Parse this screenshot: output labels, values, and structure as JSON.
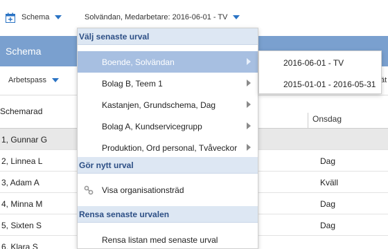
{
  "toolbar": {
    "schema_label": "Schema",
    "selection_label": "Solvändan, Medarbetare: 2016-06-01 - TV",
    "accent": "#2a73c4"
  },
  "band": {
    "title": "Schema",
    "color": "#7aa0cf"
  },
  "toolbar2": {
    "arbetspass_label": "Arbetspass",
    "right_fragment": "ät"
  },
  "grid": {
    "col_schemarad": "Schemarad",
    "col_onsdag": "Onsdag",
    "rows": [
      {
        "name": "1, Gunnar G",
        "onsdag": ""
      },
      {
        "name": "2, Linnea L",
        "onsdag": "Dag"
      },
      {
        "name": "3, Adam A",
        "onsdag": "Kväll"
      },
      {
        "name": "4, Minna M",
        "onsdag": "Dag"
      },
      {
        "name": "5, Sixten S",
        "onsdag": "Dag"
      },
      {
        "name": "6, Klara S",
        "onsdag": ""
      }
    ]
  },
  "dropdown": {
    "recent_header": "Välj senaste urval",
    "recent_items": [
      "Boende, Solvändan",
      "Bolag B, Teem 1",
      "Kastanjen, Grundschema, Dag",
      "Bolag A, Kundservicegrupp",
      "Produktion, Ord personal, Tvåveckor"
    ],
    "new_header": "Gör nytt urval",
    "org_item": "Visa organisationsträd",
    "clear_header": "Rensa senaste urvalen",
    "clear_item": "Rensa listan med senaste urval"
  },
  "submenu": {
    "items": [
      "2016-06-01 - TV",
      "2015-01-01 - 2016-05-31"
    ]
  }
}
